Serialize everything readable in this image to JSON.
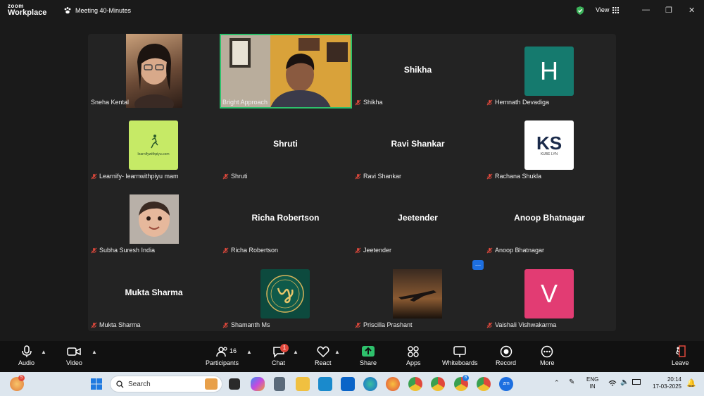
{
  "app": {
    "logo_top": "zoom",
    "logo_bottom": "Workplace",
    "meeting_title": "Meeting 40-Minutes",
    "view_label": "View"
  },
  "colors": {
    "active_border": "#2ec16c",
    "mic_off": "#e0483c",
    "secure": "#3cb35a"
  },
  "participants": [
    {
      "label": "Sneha Kental",
      "type": "photo",
      "muted": false
    },
    {
      "label": "Bright Approach",
      "type": "photo",
      "muted": false,
      "active_speaker": true
    },
    {
      "label": "Shikha",
      "type": "name",
      "center_name": "Shikha",
      "muted": true
    },
    {
      "label": "Hemnath Devadiga",
      "type": "avatar",
      "avatar_text": "H",
      "avatar_color": "#157a6e",
      "muted": true
    },
    {
      "label": "Learnify- learnwithpiyu mam",
      "type": "logo",
      "muted": true,
      "logo_text": "learnifywithpiyu.com"
    },
    {
      "label": "Shruti",
      "type": "name",
      "center_name": "Shruti",
      "muted": true
    },
    {
      "label": "Ravi Shankar",
      "type": "name",
      "center_name": "Ravi Shankar",
      "muted": true
    },
    {
      "label": "Rachana Shukla",
      "type": "logo",
      "muted": true,
      "logo_text": "KS",
      "logo_sub": "KUBE LYN"
    },
    {
      "label": "Subha Suresh India",
      "type": "photo",
      "muted": true
    },
    {
      "label": "Richa Robertson",
      "type": "name",
      "center_name": "Richa Robertson",
      "muted": true
    },
    {
      "label": "Jeetender",
      "type": "name",
      "center_name": "Jeetender",
      "muted": true
    },
    {
      "label": "Anoop Bhatnagar",
      "type": "name",
      "center_name": "Anoop Bhatnagar",
      "muted": true
    },
    {
      "label": "Mukta Sharma",
      "type": "name",
      "center_name": "Mukta Sharma",
      "muted": true
    },
    {
      "label": "Shamanth Ms",
      "type": "logo",
      "muted": true
    },
    {
      "label": "Priscilla Prashant",
      "type": "photo",
      "muted": true
    },
    {
      "label": "Vaishali Vishwakarma",
      "type": "avatar",
      "avatar_text": "V",
      "avatar_color": "#e23c73",
      "muted": true
    }
  ],
  "toolbar": {
    "audio": "Audio",
    "video": "Video",
    "participants": "Participants",
    "participants_count": "16",
    "chat": "Chat",
    "chat_badge": "1",
    "react": "React",
    "share": "Share",
    "apps": "Apps",
    "whiteboards": "Whiteboards",
    "record": "Record",
    "more": "More",
    "leave": "Leave"
  },
  "taskbar": {
    "search_placeholder": "Search",
    "lang_top": "ENG",
    "lang_bottom": "IN",
    "time": "20:14",
    "date": "17-03-2025",
    "notif_badge": "5",
    "edge_badge": "6"
  }
}
